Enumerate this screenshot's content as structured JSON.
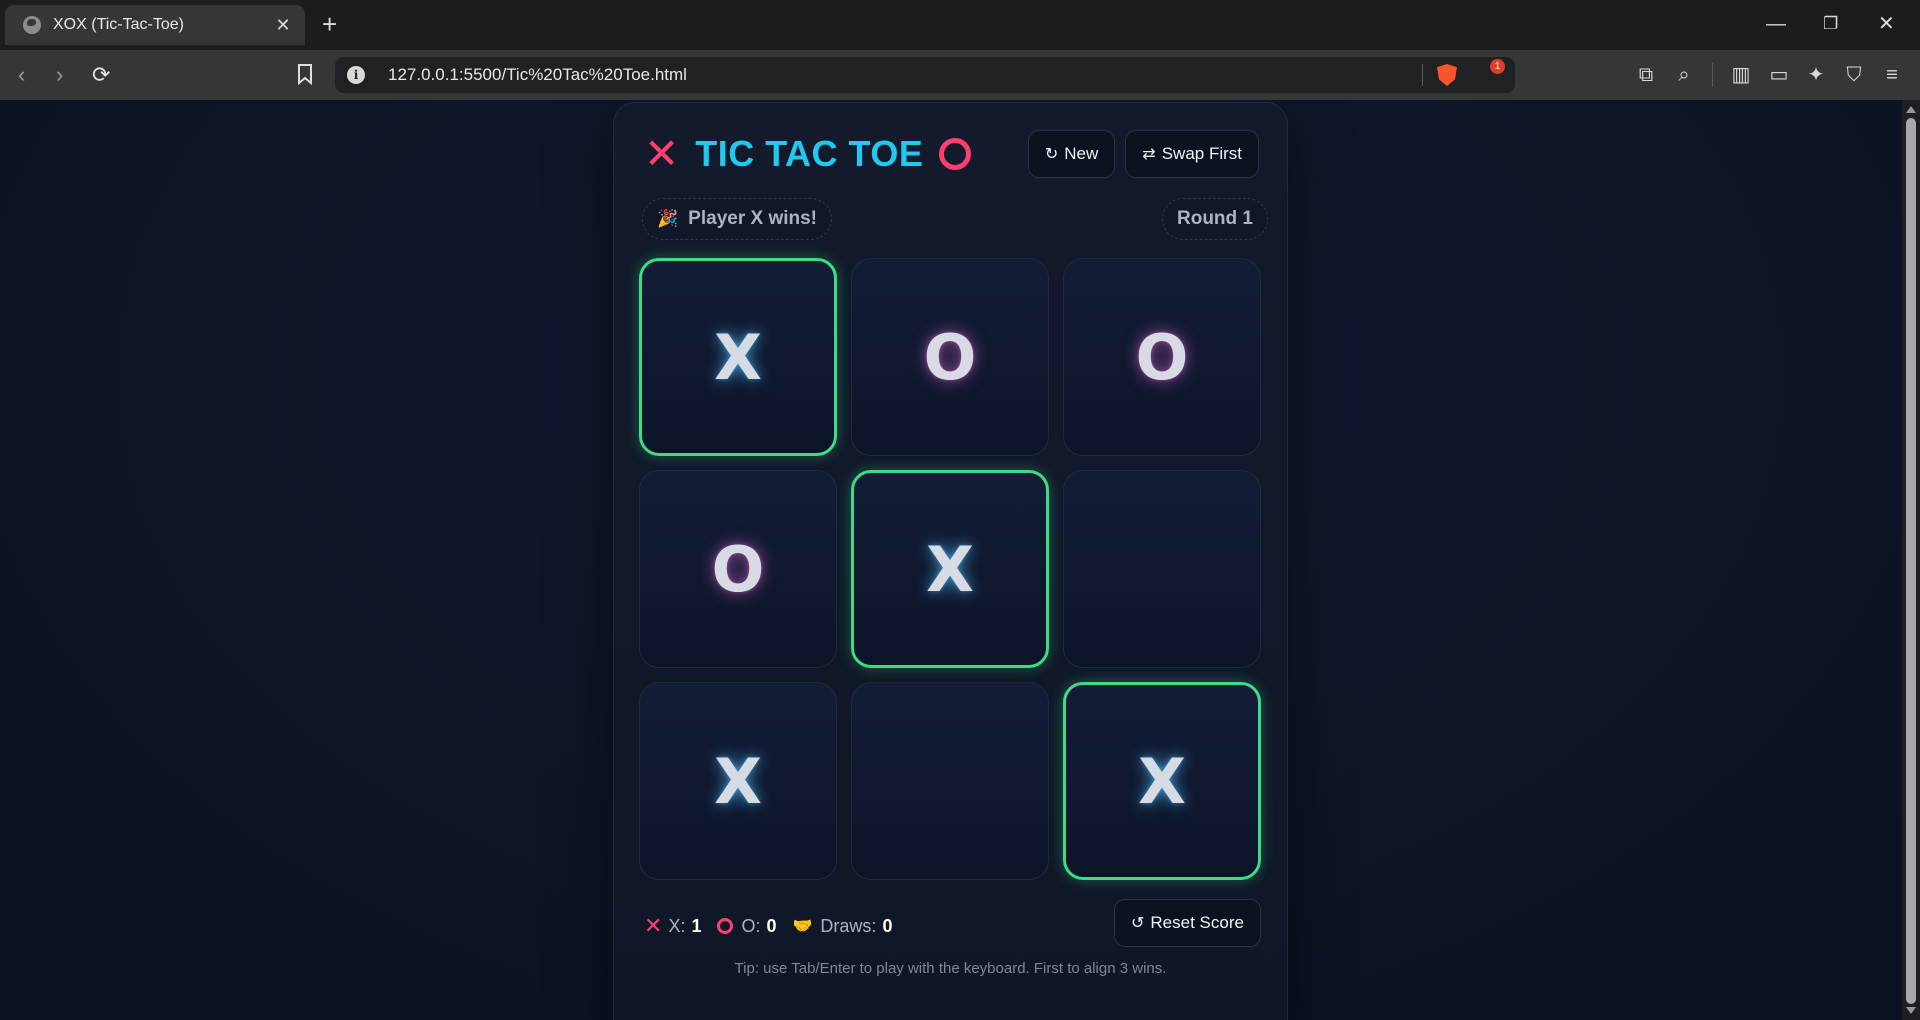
{
  "browser": {
    "tab_title": "XOX (Tic-Tac-Toe)",
    "tab_close": "✕",
    "new_tab": "+",
    "url": "127.0.0.1:5500/Tic%20Tac%20Toe.html",
    "rewards_badge": "1",
    "window_controls": {
      "minimize": "—",
      "restore": "❐",
      "close": "✕"
    }
  },
  "game": {
    "title": "TIC TAC TOE",
    "title_x_icon": "✕",
    "buttons": {
      "new_icon": "↻",
      "new_label": "New",
      "swap_icon": "⇄",
      "swap_label": "Swap First",
      "reset_icon": "↺",
      "reset_label": "Reset Score"
    },
    "status_icon": "🎉",
    "status": "Player X wins!",
    "round": "Round 1",
    "board": [
      "X",
      "O",
      "O",
      "O",
      "X",
      "",
      "X",
      "",
      "X"
    ],
    "winning_cells": [
      0,
      4,
      8
    ],
    "score": {
      "x_label": "X:",
      "x": "1",
      "o_label": "O:",
      "o": "0",
      "draws_icon": "🤝",
      "draws_label": "Draws:",
      "draws": "0"
    },
    "tip": "Tip: use Tab/Enter to play with the keyboard. First to align 3 wins."
  },
  "colors": {
    "accent_pink": "#ff3d6e",
    "accent_cyan": "#23c8f0",
    "win_green": "#3ddc84",
    "background": "#0d1424"
  }
}
